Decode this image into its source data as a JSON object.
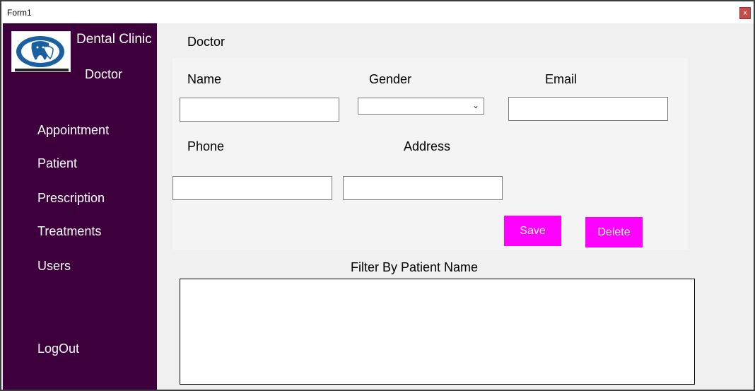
{
  "window": {
    "title": "Form1",
    "close_label": "x"
  },
  "sidebar": {
    "brand": "Dental Clinic",
    "current_section": "Doctor",
    "items": [
      {
        "label": "Appointment"
      },
      {
        "label": "Patient"
      },
      {
        "label": "Prescription"
      },
      {
        "label": "Treatments"
      },
      {
        "label": "Users"
      }
    ],
    "logout": "LogOut"
  },
  "main": {
    "title": "Doctor",
    "form": {
      "name_label": "Name",
      "name_value": "",
      "gender_label": "Gender",
      "gender_value": "",
      "email_label": "Email",
      "email_value": "",
      "phone_label": "Phone",
      "phone_value": "",
      "address_label": "Address",
      "address_value": ""
    },
    "buttons": {
      "save": "Save",
      "delete": "Delete"
    },
    "filter_label": "Filter By Patient Name"
  },
  "colors": {
    "sidebar": "#3d003d",
    "accent_button": "#ff00ff",
    "close_button": "#c24b4b",
    "logo_blue": "#1a5fa0"
  },
  "icons": {
    "logo": "tooth-logo-icon",
    "dropdown": "chevron-down-icon",
    "close": "close-icon"
  }
}
